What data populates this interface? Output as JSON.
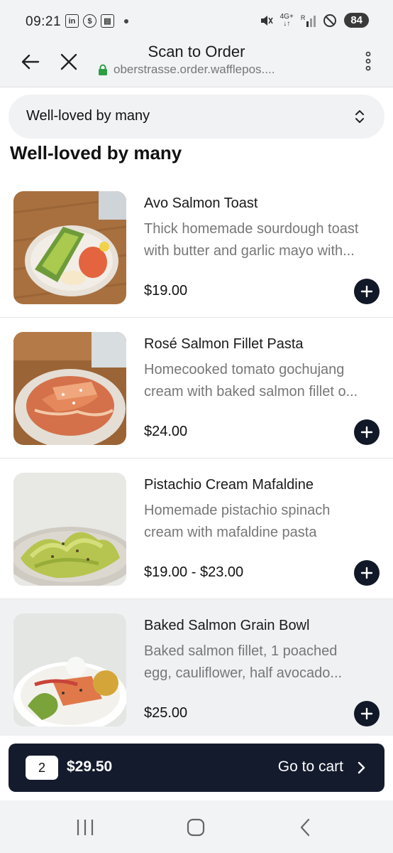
{
  "status_bar": {
    "time": "09:21",
    "battery": "84",
    "network": "4G+",
    "signal_label": "R"
  },
  "header": {
    "title": "Scan to Order",
    "url": "oberstrasse.order.wafflepos...."
  },
  "category": {
    "selected": "Well-loved by many"
  },
  "section": {
    "heading": "Well-loved by many"
  },
  "items": [
    {
      "name": "Avo Salmon Toast",
      "desc_line1": "Thick homemade sourdough toast",
      "desc_line2": "with butter and garlic mayo with...",
      "price": "$19.00"
    },
    {
      "name": "Rosé Salmon Fillet Pasta",
      "desc_line1": "Homecooked tomato gochujang",
      "desc_line2": "cream with baked salmon fillet o...",
      "price": "$24.00"
    },
    {
      "name": "Pistachio Cream Mafaldine",
      "desc_line1": "Homemade pistachio spinach",
      "desc_line2": "cream with mafaldine pasta",
      "price": "$19.00 - $23.00"
    },
    {
      "name": "Baked Salmon Grain Bowl",
      "desc_line1": "Baked salmon fillet, 1 poached",
      "desc_line2": "egg, cauliflower, half avocado...",
      "price": "$25.00"
    }
  ],
  "cart": {
    "count": "2",
    "total": "$29.50",
    "go_label": "Go to cart"
  },
  "colors": {
    "accent_dark": "#141b2d",
    "lock_green": "#2e9e44"
  }
}
